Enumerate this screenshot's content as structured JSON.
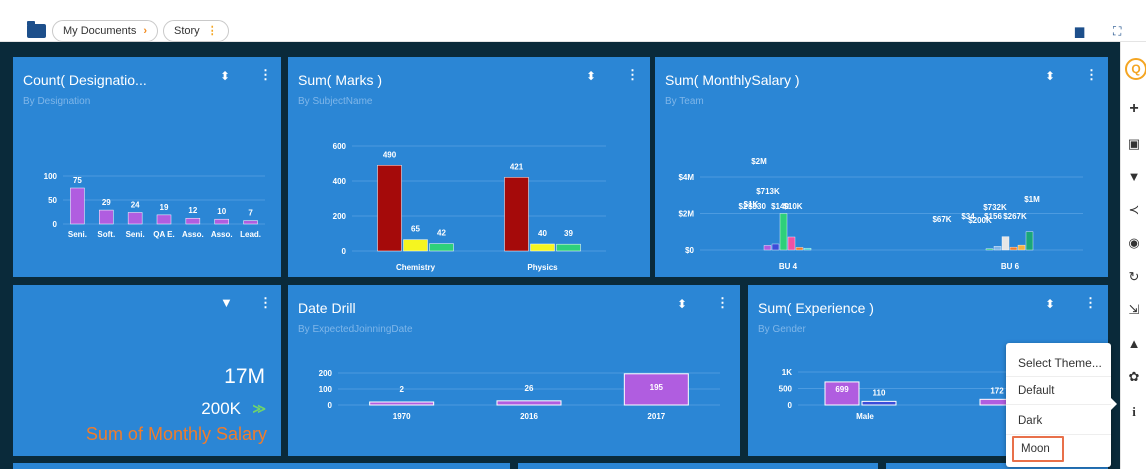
{
  "breadcrumb": {
    "items": [
      "My Documents",
      "Story"
    ],
    "arrow": "›",
    "menu": "⋮"
  },
  "colors": {
    "panel": "#2b86d5",
    "canvas": "#0a2a3a",
    "accent": "#f4a522",
    "orange": "#f07c2b"
  },
  "icons": {
    "comment": "comment-icon",
    "expand": "expand-icon"
  },
  "panels": {
    "designation": {
      "title": "Count( Designatio...",
      "subtitle": "By Designation"
    },
    "marks": {
      "title": "Sum( Marks )",
      "subtitle": "By SubjectName"
    },
    "salary": {
      "title": "Sum( MonthlySalary )",
      "subtitle": "By Team"
    },
    "kpi": {
      "value": "17M",
      "sub_value": "200K",
      "label": "Sum of Monthly Salary"
    },
    "date": {
      "title": "Date Drill",
      "subtitle": "By ExpectedJoinningDate"
    },
    "experience": {
      "title": "Sum( Experience )",
      "subtitle": "By Gender"
    }
  },
  "theme_menu": {
    "title": "Select Theme...",
    "options": [
      "Default",
      "Dark",
      "Moon"
    ],
    "selected": "Moon"
  },
  "right_toolbar": [
    "search-icon",
    "add-icon",
    "save-icon",
    "filter-icon",
    "share-icon",
    "preview-icon",
    "refresh-icon",
    "export-icon",
    "notification-icon",
    "settings-icon",
    "info-icon"
  ],
  "chart_data": [
    {
      "type": "bar",
      "categories": [
        "Seni.",
        "Soft.",
        "Seni.",
        "QA E.",
        "Asso.",
        "Asso.",
        "Lead."
      ],
      "values": [
        75,
        29,
        24,
        19,
        12,
        10,
        7
      ],
      "yticks": [
        "0",
        "50",
        "100"
      ],
      "ylim": [
        0,
        100
      ],
      "colors": [
        "#b05de0"
      ]
    },
    {
      "type": "bar",
      "categories": [
        "Chemistry",
        "Physics"
      ],
      "series": [
        {
          "values": [
            490,
            421
          ],
          "color": "#a50a0a"
        },
        {
          "values": [
            65,
            40
          ],
          "color": "#f5f520"
        },
        {
          "values": [
            42,
            39
          ],
          "color": "#2ed07a"
        }
      ],
      "yticks": [
        "0",
        "200",
        "400",
        "600"
      ],
      "ylim": [
        0,
        600
      ]
    },
    {
      "type": "bar",
      "categories": [
        "BU 4",
        "BU 6"
      ],
      "yticks": [
        "$0",
        "$2M",
        "$4M"
      ],
      "ylim": [
        0,
        4000000
      ],
      "groups": [
        {
          "bars": [
            {
              "value": 250000,
              "color": "#b05de0"
            },
            {
              "value": 330000,
              "color": "#3a4cd9"
            },
            {
              "value": 2000000,
              "color": "#2ed07a"
            },
            {
              "value": 713000,
              "color": "#f051a2"
            },
            {
              "value": 140000,
              "color": "#f07c2b"
            },
            {
              "value": 100000,
              "color": "#2ed0d0"
            }
          ]
        },
        {
          "bars": [
            {
              "value": 67000,
              "color": "#2ed07a"
            },
            {
              "value": 200000,
              "color": "#7fb6e9"
            },
            {
              "value": 732000,
              "color": "#e6e6e6"
            },
            {
              "value": 156000,
              "color": "#f07c2b"
            },
            {
              "value": 267000,
              "color": "#f5b142"
            },
            {
              "value": 1000000,
              "color": "#1aa67a"
            }
          ]
        }
      ],
      "labels": [
        {
          "text": "$2M"
        },
        {
          "text": "$713K"
        },
        {
          "text": "$2"
        },
        {
          "text": "$330"
        },
        {
          "text": "$1K"
        },
        {
          "text": "$140"
        },
        {
          "text": "$10K"
        },
        {
          "text": "$1M"
        },
        {
          "text": "$732K"
        },
        {
          "text": "$67K"
        },
        {
          "text": "$200K"
        },
        {
          "text": "$34"
        },
        {
          "text": "$156"
        },
        {
          "text": "$267K"
        }
      ]
    },
    {
      "type": "bar",
      "categories": [
        "1970",
        "2016",
        "2017"
      ],
      "values": [
        2,
        26,
        195
      ],
      "yticks": [
        "0",
        "100",
        "200"
      ],
      "ylim": [
        0,
        200
      ],
      "colors": [
        "#b05de0"
      ]
    },
    {
      "type": "bar",
      "categories": [
        "Male",
        "Fema"
      ],
      "series": [
        {
          "values": [
            699,
            172
          ],
          "color": "#b05de0"
        },
        {
          "values": [
            110,
            null
          ],
          "color": "#3a4cd9"
        }
      ],
      "yticks": [
        "0",
        "500",
        "1K"
      ],
      "ylim": [
        0,
        1000
      ]
    }
  ]
}
